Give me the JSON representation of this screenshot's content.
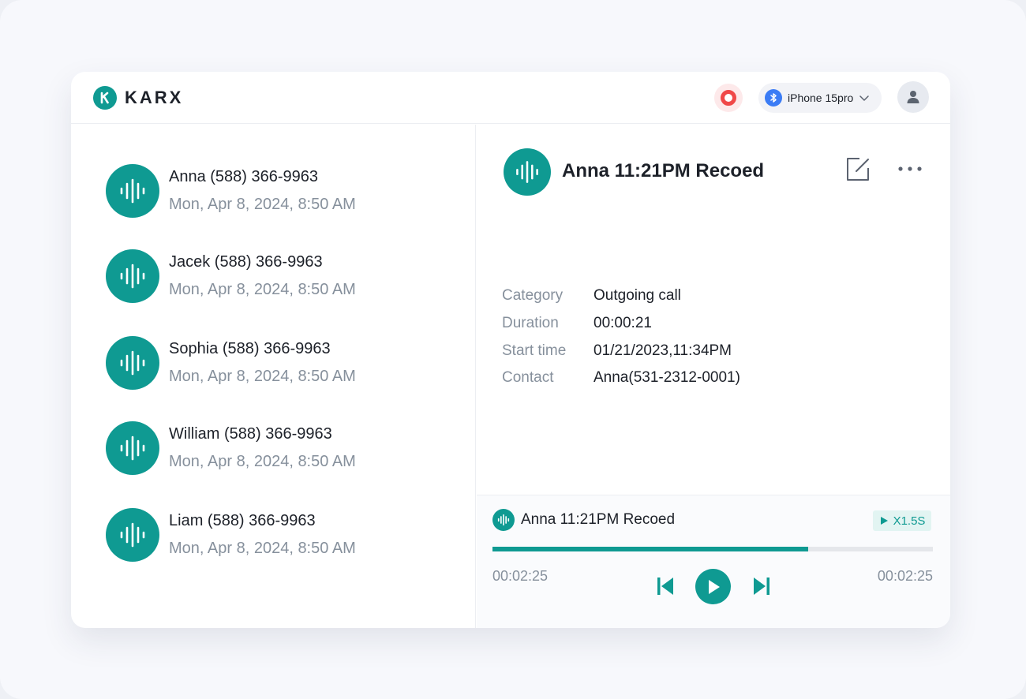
{
  "app": {
    "brand": "KARX",
    "accent": "#0f9a92"
  },
  "header": {
    "record_icon": "record-icon",
    "device_icon": "bluetooth-icon",
    "device_name": "iPhone 15pro",
    "avatar_icon": "user-icon"
  },
  "recordings": [
    {
      "name": "Anna (588) 366-9963",
      "date": "Mon, Apr 8, 2024, 8:50 AM"
    },
    {
      "name": "Jacek (588) 366-9963",
      "date": "Mon, Apr 8, 2024, 8:50 AM"
    },
    {
      "name": "Sophia (588) 366-9963",
      "date": "Mon, Apr 8, 2024, 8:50 AM"
    },
    {
      "name": "William (588) 366-9963",
      "date": "Mon, Apr 8, 2024, 8:50 AM"
    },
    {
      "name": "Liam (588) 366-9963",
      "date": "Mon, Apr 8, 2024, 8:50 AM"
    }
  ],
  "detail": {
    "title": "Anna 11:21PM Recoed",
    "fields": [
      {
        "label": "Category",
        "value": "Outgoing call"
      },
      {
        "label": "Duration",
        "value": "00:00:21"
      },
      {
        "label": "Start time",
        "value": "01/21/2023,11:34PM"
      },
      {
        "label": "Contact",
        "value": "Anna(531-2312-0001)"
      }
    ]
  },
  "player": {
    "title": "Anna 11:21PM Recoed",
    "speed": "X1.5S",
    "progress": 0.717,
    "elapsed": "00:02:25",
    "total": "00:02:25"
  }
}
